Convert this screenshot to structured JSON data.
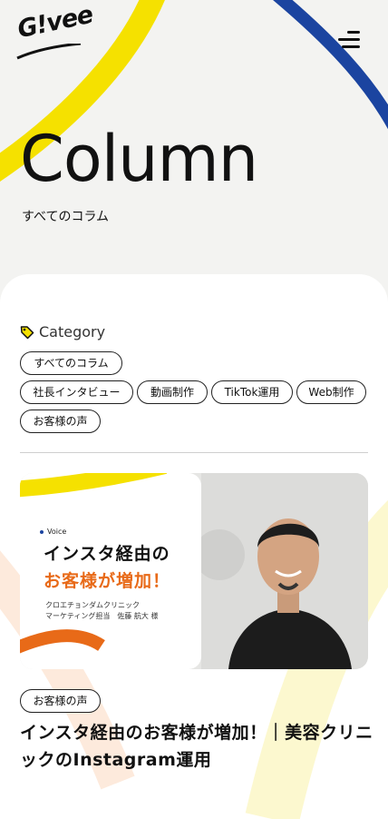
{
  "header": {
    "logo_text": "G!vee",
    "menu_icon": "hamburger-icon"
  },
  "hero": {
    "title": "Column",
    "subtitle": "すべてのコラム"
  },
  "category": {
    "heading": "Category",
    "icon": "tag-icon",
    "pills": [
      "すべてのコラム",
      "社長インタビュー",
      "動画制作",
      "TikTok運用",
      "Web制作",
      "お客様の声"
    ]
  },
  "article": {
    "thumbnail": {
      "label": "Voice",
      "headline_line1": "インスタ経由の",
      "headline_line2": "お客様が増加！",
      "caption_line1": "クロエチョンダムクリニック",
      "caption_line2": "マーケティング担当　佐藤 航大 様"
    },
    "tag": "お客様の声",
    "title": "インスタ経由のお客様が増加！｜美容クリニックのInstagram運用"
  },
  "colors": {
    "yellow": "#f5e100",
    "blue": "#1b44a0",
    "orange": "#e86a18",
    "page_bg": "#f3f3f1"
  }
}
